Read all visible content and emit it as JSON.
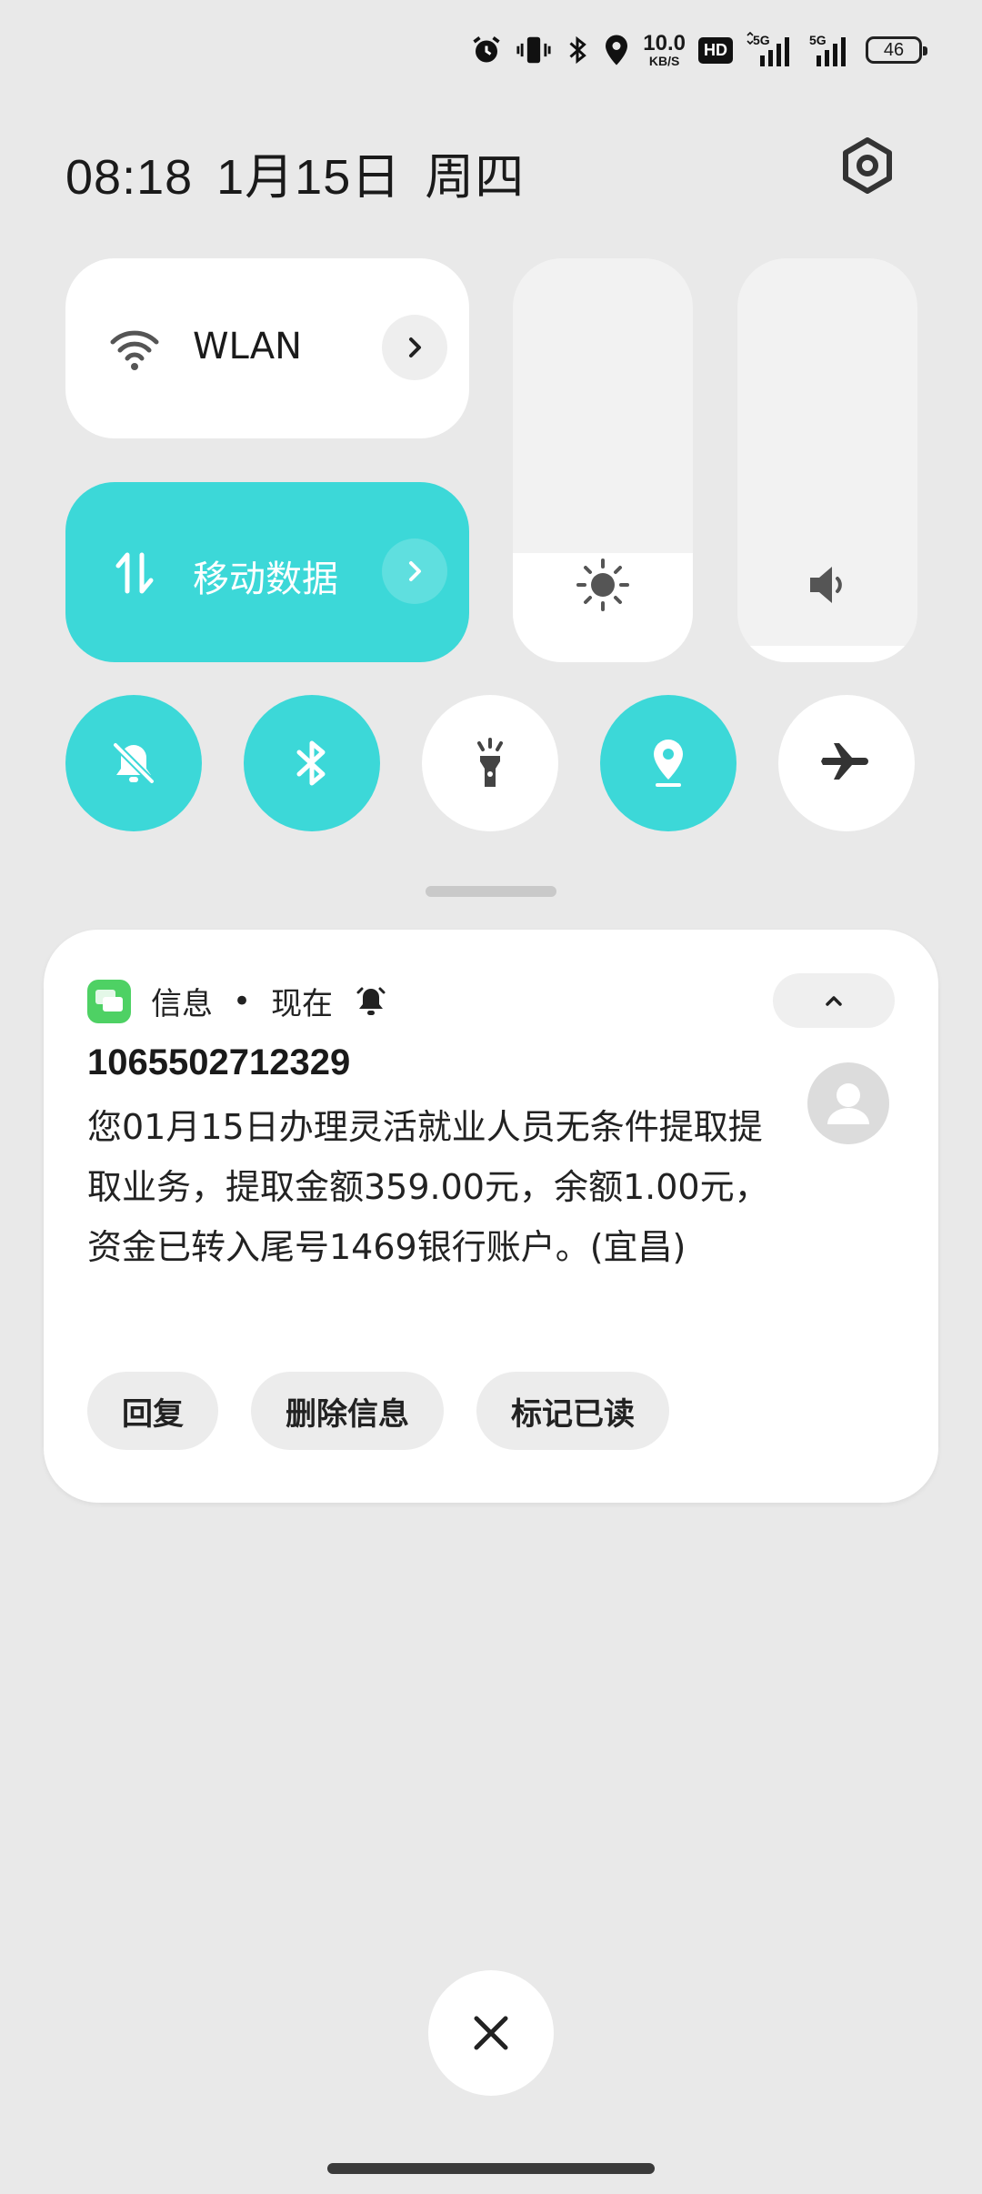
{
  "status_bar": {
    "net_speed_value": "10.0",
    "net_speed_unit": "KB/S",
    "hd_badge": "HD",
    "signal1_label": "5G",
    "signal2_label": "5G",
    "battery_level": "46",
    "icons": [
      "alarm-icon",
      "vibrate-icon",
      "bluetooth-icon",
      "location-icon",
      "hd-voice-icon",
      "signal-icon",
      "signal-icon",
      "battery-icon"
    ]
  },
  "header": {
    "time": "08:18",
    "date": "1月15日",
    "weekday": "周四",
    "settings_icon": "gear-icon"
  },
  "quick_tiles": {
    "wlan": {
      "label": "WLAN",
      "icon": "wifi-icon",
      "arrow_icon": "chevron-right-icon"
    },
    "mobile_data": {
      "label": "移动数据",
      "icon": "mobile-data-icon",
      "arrow_icon": "chevron-right-icon",
      "active": true
    },
    "brightness": {
      "icon": "sun-icon",
      "level": 0.27
    },
    "volume": {
      "icon": "speaker-icon",
      "level": 0.04
    }
  },
  "toggles": [
    {
      "name": "mute",
      "icon": "bell-off-icon",
      "on": true
    },
    {
      "name": "bluetooth",
      "icon": "bluetooth-icon",
      "on": true
    },
    {
      "name": "flashlight",
      "icon": "flashlight-icon",
      "on": false
    },
    {
      "name": "location",
      "icon": "location-icon",
      "on": true
    },
    {
      "name": "airplane",
      "icon": "airplane-icon",
      "on": false
    }
  ],
  "notification": {
    "app_name": "信息",
    "separator": "•",
    "time": "现在",
    "sender": "1065502712329",
    "body": "您01月15日办理灵活就业人员无条件提取提取业务，提取金额359.00元，余额1.00元，资金已转入尾号1469银行账户。(宜昌)",
    "actions": {
      "reply": "回复",
      "delete": "删除信息",
      "mark_read": "标记已读"
    }
  },
  "colors": {
    "accent": "#3cd8d8",
    "background": "#e9e9e9",
    "card": "#ffffff",
    "message_app": "#4ed164"
  }
}
